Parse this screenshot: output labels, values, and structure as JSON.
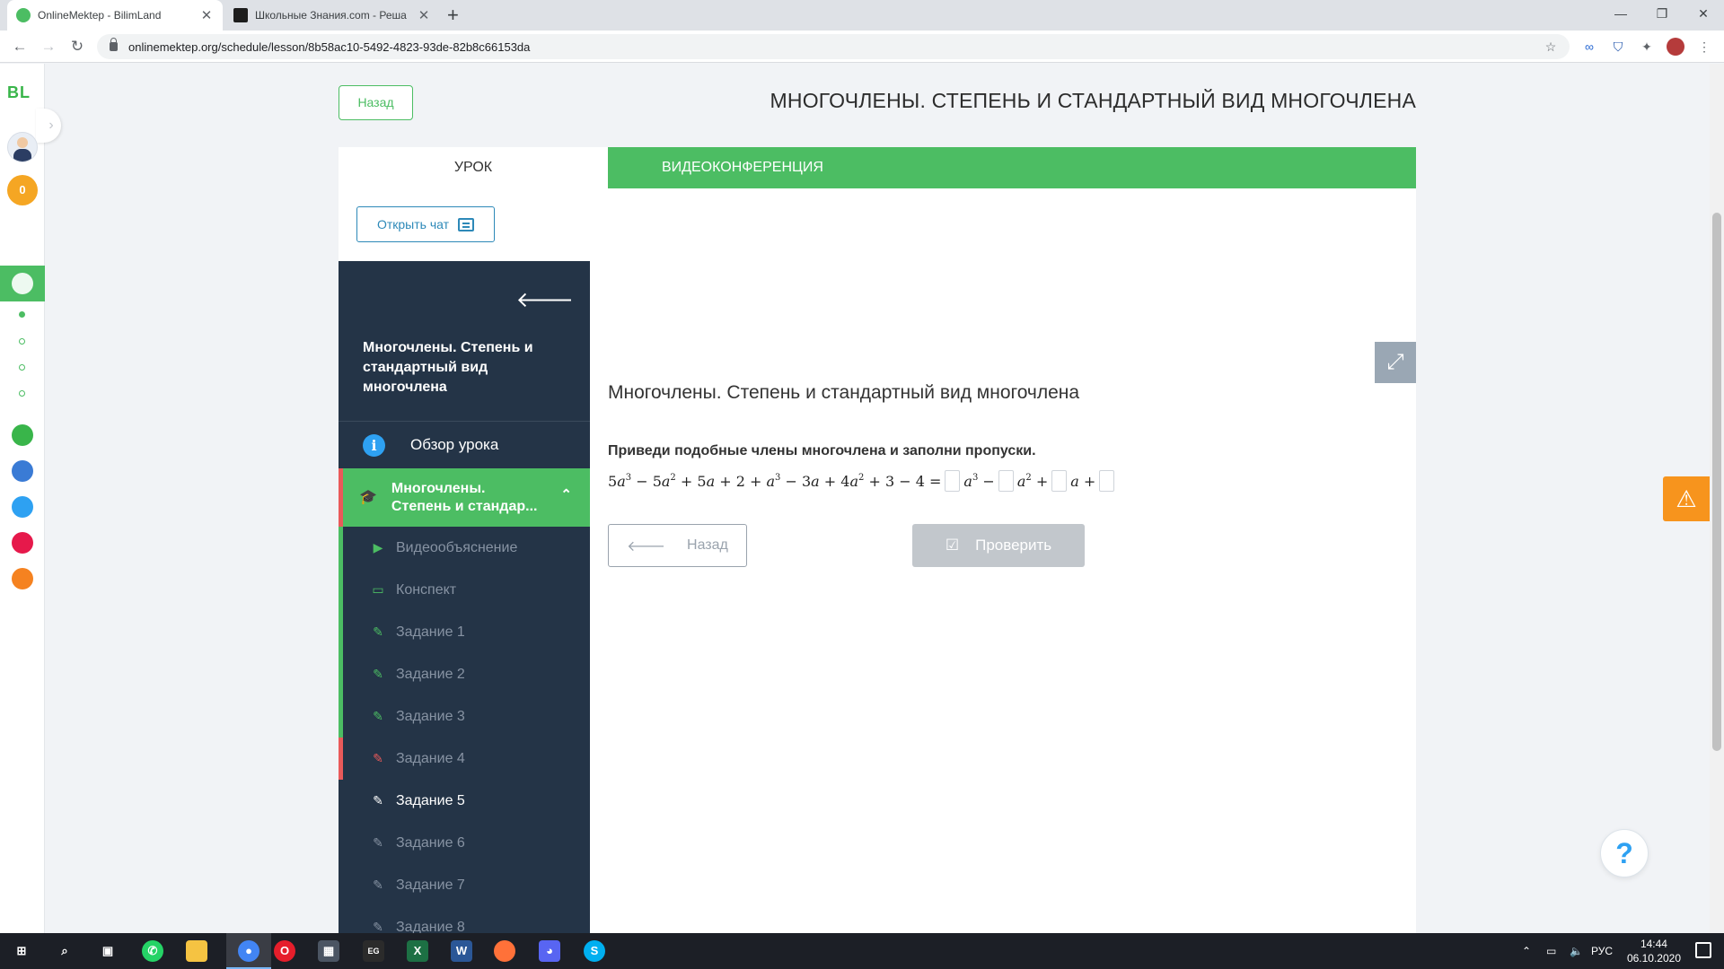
{
  "browser": {
    "tabs": [
      {
        "title": "OnlineMektep - BilimLand",
        "favicon_color": "#4cbd63",
        "active": true
      },
      {
        "title": "Школьные Знания.com - Реша",
        "favicon_color": "#1d1d1d",
        "active": false
      }
    ],
    "url": "onlinemektep.org/schedule/lesson/8b58ac10-5492-4823-93de-82b8c66153da"
  },
  "rail": {
    "logo": "BL",
    "coins": "0"
  },
  "header": {
    "back_label": "Назад",
    "title": "МНОГОЧЛЕНЫ. СТЕПЕНЬ И СТАНДАРТНЫЙ ВИД МНОГОЧЛЕНА"
  },
  "tabs": {
    "lesson": "УРОК",
    "video": "ВИДЕОКОНФЕРЕНЦИЯ"
  },
  "chat_button": "Открыть чат",
  "sidebar": {
    "title": "Многочлены. Степень и стандартный вид многочлена",
    "overview": "Обзор урока",
    "current_section": "Многочлены. Степень и стандар...",
    "items": [
      {
        "label": "Видеообъяснение",
        "icon": "play-icon",
        "status": "done"
      },
      {
        "label": "Конспект",
        "icon": "book-icon",
        "status": "done"
      },
      {
        "label": "Задание 1",
        "icon": "edit-icon",
        "status": "done"
      },
      {
        "label": "Задание 2",
        "icon": "edit-icon",
        "status": "done"
      },
      {
        "label": "Задание 3",
        "icon": "edit-icon",
        "status": "done"
      },
      {
        "label": "Задание 4",
        "icon": "edit-icon",
        "status": "wrong"
      },
      {
        "label": "Задание 5",
        "icon": "edit-icon",
        "status": "current"
      },
      {
        "label": "Задание 6",
        "icon": "edit-icon",
        "status": "pending"
      },
      {
        "label": "Задание 7",
        "icon": "edit-icon",
        "status": "pending"
      },
      {
        "label": "Задание 8",
        "icon": "edit-icon",
        "status": "pending"
      }
    ]
  },
  "task": {
    "heading": "Многочлены. Степень и стандартный вид многочлена",
    "instruction": "Приведи подобные члены многочлена и заполни пропуски.",
    "back_label": "Назад",
    "check_label": "Проверить"
  },
  "taskbar": {
    "lang": "РУС",
    "time": "14:44",
    "date": "06.10.2020"
  },
  "colors": {
    "accent": "#4cbd63",
    "sidebar_bg": "#243447",
    "error": "#e95a5a",
    "warning": "#f7941d",
    "info": "#2ea1f2"
  }
}
